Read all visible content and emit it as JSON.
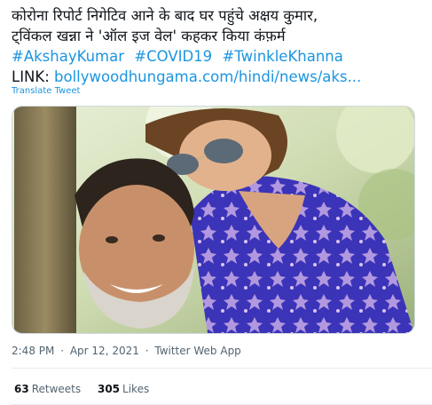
{
  "tweet": {
    "line1": "कोरोना रिपोर्ट निगेटिव आने के बाद घर पहुंचे अक्षय कुमार,",
    "line2": "ट्विंकल खन्ना ने 'ऑल इज वेल' कहकर किया कंफ़र्म",
    "hashtags": [
      "#AkshayKumar",
      "#COVID19",
      "#TwinkleKhanna"
    ],
    "link_prefix": "LINK:",
    "link_text": "bollywoodhungama.com/hindi/news/aks..."
  },
  "translate_label": "Translate Tweet",
  "meta": {
    "time": "2:48 PM",
    "date": "Apr 12, 2021",
    "source": "Twitter Web App",
    "separator": "·"
  },
  "stats": {
    "retweets_count": "63",
    "retweets_label": "Retweets",
    "likes_count": "305",
    "likes_label": "Likes"
  },
  "colors": {
    "link": "#1b95e0",
    "text": "#0f1419",
    "muted": "#536471",
    "divider": "#e6ecf0"
  }
}
